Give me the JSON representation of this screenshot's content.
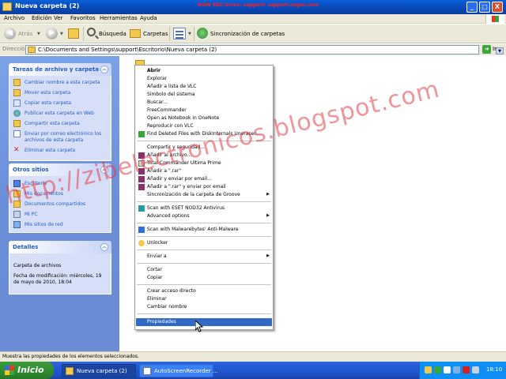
{
  "window": {
    "title": "Nueva carpeta (2)",
    "recording_banner": "NOW REC.Scree. support: support.orgen.com",
    "buttons": [
      "_",
      "□",
      "X"
    ]
  },
  "menubar": [
    "Archivo",
    "Edición",
    "Ver",
    "Favoritos",
    "Herramientas",
    "Ayuda"
  ],
  "toolbar": {
    "back": "Atrás",
    "search": "Búsqueda",
    "folders": "Carpetas",
    "sync": "Sincronización de carpetas"
  },
  "address": {
    "label": "Dirección",
    "value": "C:\\Documents and Settings\\support\\Escritorio\\Nueva carpeta (2)",
    "go": "Ir"
  },
  "left_pane": {
    "file_tasks": {
      "title": "Tareas de archivo y carpeta",
      "items": [
        "Cambiar nombre a esta carpeta",
        "Mover esta carpeta",
        "Copiar esta carpeta",
        "Publicar esta carpeta en Web",
        "Compartir esta carpeta",
        "Enviar por correo electrónico los",
        "archivos de esta carpeta",
        "Eliminar esta carpeta"
      ]
    },
    "other_places": {
      "title": "Otros sitios",
      "items": [
        "Escritorio",
        "Mis documentos",
        "Documentos compartidos",
        "Mi PC",
        "Mis sitios de red"
      ]
    },
    "details": {
      "title": "Detalles",
      "line1": "Carpeta de archivos",
      "line2": "Fecha de modificación: miércoles, 19",
      "line3": "de mayo de 2010, 18:04"
    }
  },
  "context_menu": {
    "items": [
      "Abrir",
      "Explorar",
      "Añadir a lista de VLC",
      "Símbolo del sistema",
      "Buscar...",
      "FreeCommander",
      "Open as Notebook in OneNote",
      "Reproducir con VLC",
      "Find Deleted Files with DiskInternals Uneraser...",
      "Compartir y seguridad...",
      "Añadir al archivo...",
      "Total Commander Ultima Prime",
      "Añadir a \".rar\"",
      "Añadir y enviar por email...",
      "Añadir a \".rar\" y enviar por email",
      "Sincronización de la carpeta de Groove",
      "Scan with ESET NOD32 Antivirus",
      "Advanced options",
      "Scan with Malwarebytes' Anti-Malware",
      "Unlocker",
      "Enviar a",
      "Cortar",
      "Copiar",
      "Crear acceso directo",
      "Eliminar",
      "Cambiar nombre",
      "Propiedades"
    ]
  },
  "watermark": "http://zibelectronicos.blogspot.com",
  "statusbar": "Muestra las propiedades de los elementos seleccionados.",
  "taskbar": {
    "start": "Inicio",
    "tasks": [
      "Nueva carpeta (2)",
      "AutoScreenRecorder ..."
    ],
    "clock": "18:10"
  },
  "colors": {
    "titlebar": "#0847b3",
    "left_pane": "#6b8ed9",
    "highlight": "#316ac5",
    "taskbar": "#245edb",
    "start": "#2f8a2f"
  },
  "icons": [
    "folder-icon",
    "search-icon",
    "views-icon",
    "sync-icon",
    "back-icon",
    "forward-icon",
    "up-icon"
  ]
}
